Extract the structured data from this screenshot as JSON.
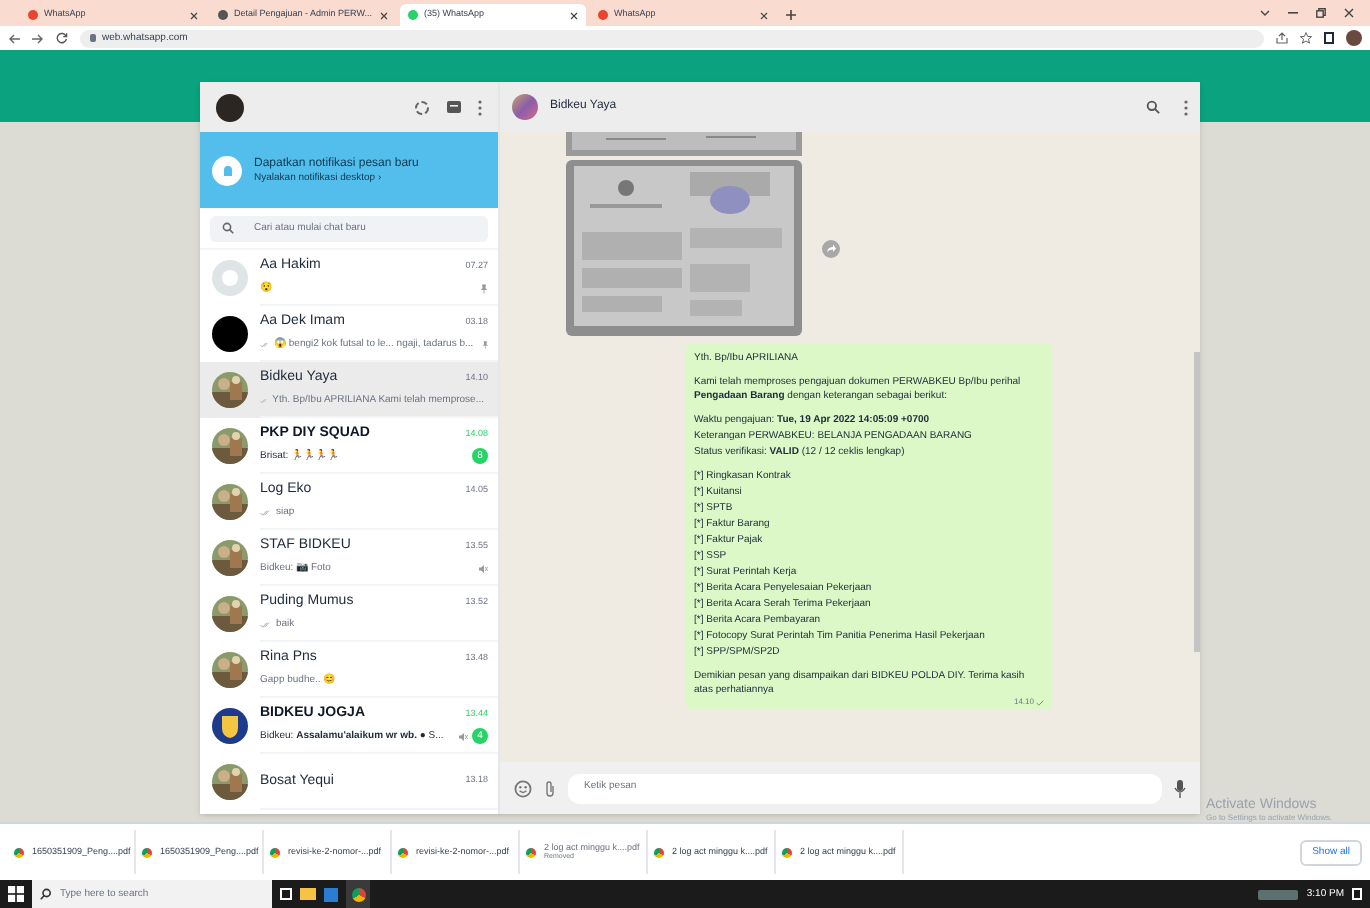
{
  "browser": {
    "tabs": [
      {
        "title": "WhatsApp",
        "selected": false,
        "kind": "alert"
      },
      {
        "title": "Detail Pengajuan - Admin PERW...",
        "selected": false,
        "kind": "page"
      },
      {
        "title": "(35) WhatsApp",
        "selected": true,
        "kind": "chat"
      },
      {
        "title": "WhatsApp",
        "selected": false,
        "kind": "alert"
      }
    ],
    "url": "web.whatsapp.com"
  },
  "sidebar": {
    "notification": {
      "title": "Dapatkan notifikasi pesan baru",
      "link": "Nyalakan notifikasi desktop ›"
    },
    "search": {
      "placeholder": "Cari atau mulai chat baru"
    },
    "chats": [
      {
        "name": "Aa Hakim",
        "time": "07.27",
        "preview": "😯",
        "kind": "blank",
        "selected": false,
        "unread": false,
        "pinned": true,
        "muted": false,
        "read": false
      },
      {
        "name": "Aa Dek Imam",
        "time": "03.18",
        "preview": "😱 bengi2 kok futsal to le... ngaji, tadarus b...",
        "kind": "dark",
        "selected": false,
        "unread": false,
        "pinned": true,
        "muted": false,
        "read": true
      },
      {
        "name": "Bidkeu Yaya",
        "time": "14.10",
        "preview": "Yth. Bp/Ibu APRILIANA Kami telah memprose...",
        "selected": true,
        "unread": false,
        "pinned": false,
        "muted": false,
        "read": true
      },
      {
        "name": "PKP DIY SQUAD",
        "time": "14.08",
        "preview": "Brisat: 🏃🏃🏃🏃",
        "selected": false,
        "unread": true,
        "badge": "8",
        "pinned": false,
        "muted": false,
        "read": false
      },
      {
        "name": "Log Eko",
        "time": "14.05",
        "preview": "siap",
        "selected": false,
        "unread": false,
        "pinned": false,
        "muted": false,
        "read": true
      },
      {
        "name": "STAF BIDKEU",
        "time": "13.55",
        "preview": "Bidkeu: 📷 Foto",
        "selected": false,
        "unread": false,
        "pinned": false,
        "muted": true,
        "read": false
      },
      {
        "name": "Puding Mumus",
        "time": "13.52",
        "preview": "baik",
        "selected": false,
        "unread": false,
        "pinned": false,
        "muted": false,
        "read": true
      },
      {
        "name": "Rina Pns",
        "time": "13.48",
        "preview": "Gapp budhe.. 😊",
        "selected": false,
        "unread": false,
        "pinned": false,
        "muted": false,
        "read": false
      },
      {
        "name": "BIDKEU JOGJA",
        "time": "13.44",
        "preview": "Bidkeu: **Assalamu'alaikum wr wb.** ● S...",
        "kind": "emblem",
        "selected": false,
        "unread": true,
        "badge": "4",
        "pinned": false,
        "muted": true,
        "read": false
      },
      {
        "name": "Bosat Yequi",
        "time": "13.18",
        "selected": false,
        "unread": false,
        "pinned": false,
        "muted": false,
        "read": false
      }
    ]
  },
  "chat": {
    "contact": "Bidkeu Yaya",
    "message": {
      "time": "14.10",
      "paragraphs": [
        [
          "Yth. Bp/Ibu APRILIANA"
        ],
        [
          "Kami telah memproses pengajuan dokumen PERWABKEU Bp/Ibu perihal **Pengadaan Barang** dengan keterangan sebagai berikut:"
        ],
        [
          "Waktu pengajuan: **Tue, 19 Apr 2022 14:05:09 +0700**",
          "Keterangan PERWABKEU: BELANJA PENGADAAN  BARANG",
          "Status verifikasi: **VALID** (12 / 12 ceklis lengkap)"
        ],
        [
          "[*] Ringkasan Kontrak",
          "[*] Kuitansi",
          "[*] SPTB",
          "[*] Faktur Barang",
          "[*] Faktur Pajak",
          "[*] SSP",
          "[*] Surat Perintah Kerja",
          "[*] Berita Acara Penyelesaian Pekerjaan",
          "[*] Berita Acara Serah Terima Pekerjaan",
          "[*] Berita Acara Pembayaran",
          "[*] Fotocopy Surat Perintah Tim Panitia Penerima Hasil Pekerjaan",
          "[*] SPP/SPM/SP2D"
        ],
        [
          "Demikian pesan yang disampaikan dari BIDKEU POLDA DIY. Terima kasih atas perhatiannya"
        ]
      ]
    },
    "input": {
      "placeholder": "Ketik pesan"
    }
  },
  "downloads": [
    {
      "file": "1650351909_Peng....pdf",
      "removed": false
    },
    {
      "file": "1650351909_Peng....pdf",
      "removed": false
    },
    {
      "file": "revisi-ke-2-nomor-...pdf",
      "removed": false
    },
    {
      "file": "revisi-ke-2-nomor-...pdf",
      "removed": false
    },
    {
      "file": "2 log act minggu k....pdf",
      "removed": true,
      "note": "Removed"
    },
    {
      "file": "2 log act minggu k....pdf",
      "removed": false
    },
    {
      "file": "2 log act minggu k....pdf",
      "removed": false
    }
  ],
  "show_all": "Show all",
  "activation": {
    "title": "Activate Windows",
    "subtitle": "Go to Settings to activate Windows."
  },
  "taskbar": {
    "search_placeholder": "Type here to search",
    "time": "3:10 PM"
  }
}
